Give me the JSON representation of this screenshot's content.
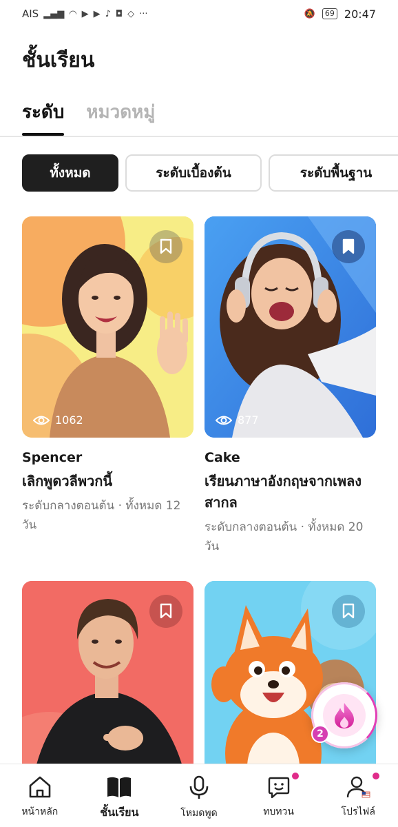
{
  "status_bar": {
    "carrier": "AIS",
    "battery": "69",
    "time": "20:47"
  },
  "page_title": "ชั้นเรียน",
  "tabs": [
    {
      "label": "ระดับ",
      "active": true
    },
    {
      "label": "หมวดหมู่",
      "active": false
    }
  ],
  "filters": [
    {
      "label": "ทั้งหมด",
      "active": true
    },
    {
      "label": "ระดับเบื้องต้น",
      "active": false
    },
    {
      "label": "ระดับพื้นฐาน",
      "active": false
    }
  ],
  "courses": [
    {
      "teacher": "Spencer",
      "title": "เลิกพูดวลีพวกนี้",
      "meta": "ระดับกลางตอนต้น · ทั้งหมด 12 วัน",
      "views": "1062",
      "bg": "#f6ee84"
    },
    {
      "teacher": "Cake",
      "title": "เรียนภาษาอังกฤษจากเพลงสากล",
      "meta": "ระดับกลางตอนต้น · ทั้งหมด 20 วัน",
      "views": "877",
      "bg": "#3f8ae6"
    },
    {
      "teacher": "",
      "title": "",
      "meta": "",
      "views": "",
      "bg": "#f06a64"
    },
    {
      "teacher": "",
      "title": "",
      "meta": "",
      "views": "",
      "bg": "#6fd0f0"
    }
  ],
  "fab": {
    "badge": "2",
    "icon": "fire-icon"
  },
  "bottom_nav": [
    {
      "label": "หน้าหลัก",
      "icon": "home-icon"
    },
    {
      "label": "ชั้นเรียน",
      "icon": "book-icon",
      "active": true
    },
    {
      "label": "โหมดพูด",
      "icon": "microphone-icon"
    },
    {
      "label": "ทบทวน",
      "icon": "smiley-chat-icon"
    },
    {
      "label": "โปรไฟล์",
      "icon": "profile-icon"
    }
  ],
  "colors": {
    "accent_dark": "#1f1f1f",
    "notification_dot": "#e02c8a"
  }
}
